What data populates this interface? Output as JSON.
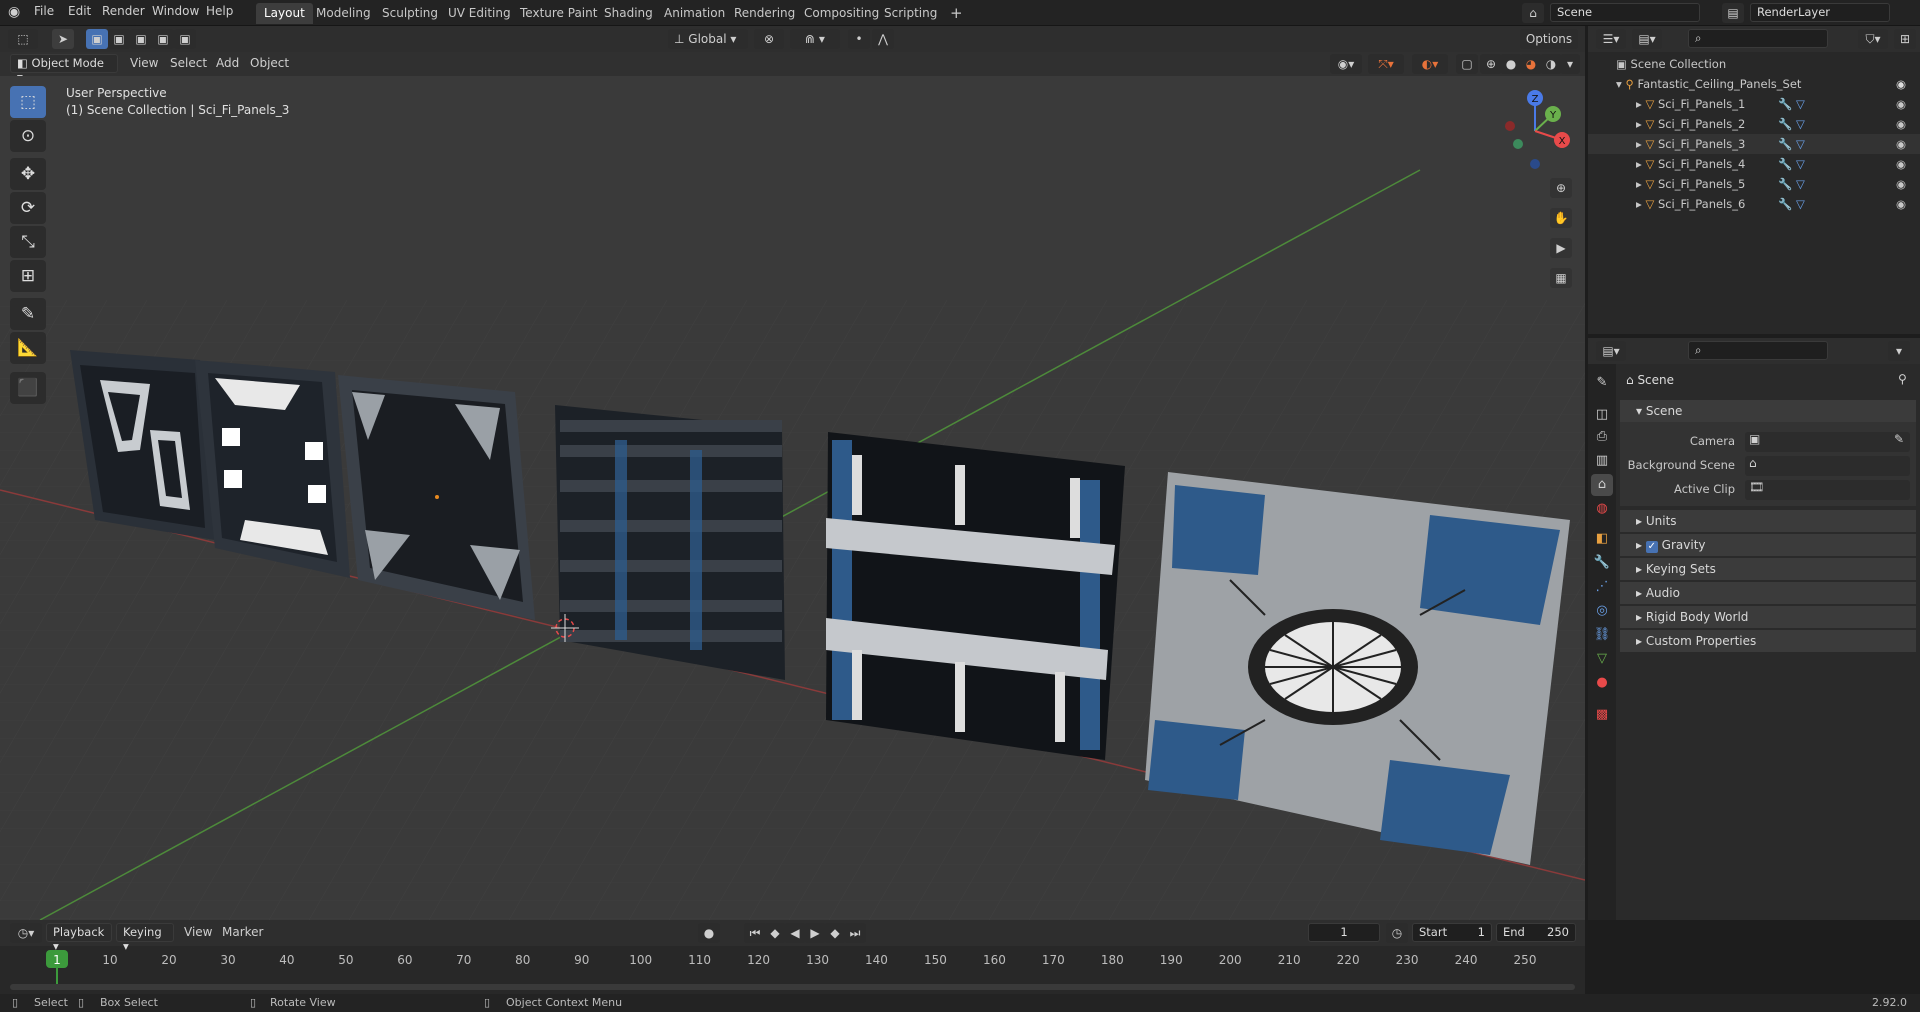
{
  "menu": {
    "items": [
      "File",
      "Edit",
      "Render",
      "Window",
      "Help"
    ]
  },
  "workspaces": [
    "Layout",
    "Modeling",
    "Sculpting",
    "UV Editing",
    "Texture Paint",
    "Shading",
    "Animation",
    "Rendering",
    "Compositing",
    "Scripting"
  ],
  "active_workspace": "Layout",
  "scene_name": "Scene",
  "render_layer": "RenderLayer",
  "viewport_header": {
    "mode": "Object Mode",
    "menus": [
      "View",
      "Select",
      "Add",
      "Object"
    ],
    "orientation": "Global",
    "options": "Options"
  },
  "viewport": {
    "perspective": "User Perspective",
    "context": "(1) Scene Collection | Sci_Fi_Panels_3"
  },
  "gizmo": {
    "z": "Z",
    "y": "Y",
    "x": "X"
  },
  "outliner": {
    "root": "Scene Collection",
    "collection": "Fantastic_Ceiling_Panels_Set",
    "objects": [
      "Sci_Fi_Panels_1",
      "Sci_Fi_Panels_2",
      "Sci_Fi_Panels_3",
      "Sci_Fi_Panels_4",
      "Sci_Fi_Panels_5",
      "Sci_Fi_Panels_6"
    ]
  },
  "properties": {
    "context": "Scene",
    "section": "Scene",
    "fields": {
      "camera": "Camera",
      "background_scene": "Background Scene",
      "active_clip": "Active Clip"
    },
    "panels": [
      "Units",
      "Gravity",
      "Keying Sets",
      "Audio",
      "Rigid Body World",
      "Custom Properties"
    ],
    "gravity_checked": true
  },
  "timeline": {
    "menus": [
      "Playback",
      "Keying",
      "View",
      "Marker"
    ],
    "current_frame": "1",
    "start_label": "Start",
    "start": "1",
    "end_label": "End",
    "end": "250",
    "ticks": [
      "1",
      "10",
      "20",
      "30",
      "40",
      "50",
      "60",
      "70",
      "80",
      "90",
      "100",
      "110",
      "120",
      "130",
      "140",
      "150",
      "160",
      "170",
      "180",
      "190",
      "200",
      "210",
      "220",
      "230",
      "240",
      "250"
    ]
  },
  "statusbar": {
    "select": "Select",
    "box_select": "Box Select",
    "rotate_view": "Rotate View",
    "context_menu": "Object Context Menu",
    "version": "2.92.0"
  },
  "colors": {
    "accent": "#4772b3",
    "active_tab": "#3d3d3d",
    "panel_blue": "#2e5a8a",
    "frame_green": "#3c9a3c"
  }
}
